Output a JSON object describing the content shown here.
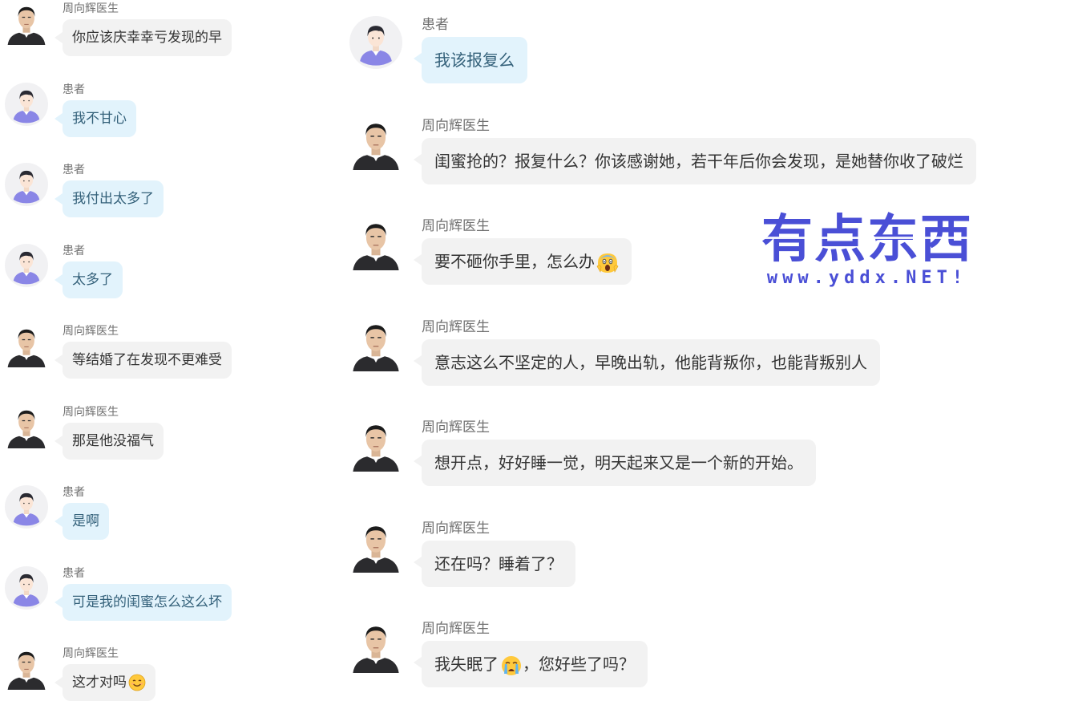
{
  "left_messages": [
    {
      "role": "doctor",
      "sender": "周向辉医生",
      "text": "你应该庆幸幸亏发现的早"
    },
    {
      "role": "patient",
      "sender": "患者",
      "text": "我不甘心"
    },
    {
      "role": "patient",
      "sender": "患者",
      "text": "我付出太多了"
    },
    {
      "role": "patient",
      "sender": "患者",
      "text": "太多了"
    },
    {
      "role": "doctor",
      "sender": "周向辉医生",
      "text": "等结婚了在发现不更难受"
    },
    {
      "role": "doctor",
      "sender": "周向辉医生",
      "text": "那是他没福气"
    },
    {
      "role": "patient",
      "sender": "患者",
      "text": "是啊"
    },
    {
      "role": "patient",
      "sender": "患者",
      "text": "可是我的闺蜜怎么这么坏"
    },
    {
      "role": "doctor",
      "sender": "周向辉医生",
      "text": "这才对吗",
      "emoji": "smiling-face-emoji"
    }
  ],
  "right_messages": [
    {
      "role": "patient",
      "sender": "患者",
      "text": "我该报复么"
    },
    {
      "role": "doctor",
      "sender": "周向辉医生",
      "text": "闺蜜抢的？报复什么？你该感谢她，若干年后你会发现，是她替你收了破烂"
    },
    {
      "role": "doctor",
      "sender": "周向辉医生",
      "text": "要不砸你手里，怎么办",
      "emoji": "screaming-face-emoji"
    },
    {
      "role": "doctor",
      "sender": "周向辉医生",
      "text": "意志这么不坚定的人，早晚出轨，他能背叛你，也能背叛别人"
    },
    {
      "role": "doctor",
      "sender": "周向辉医生",
      "text": "想开点，好好睡一觉，明天起来又是一个新的开始。"
    },
    {
      "role": "doctor",
      "sender": "周向辉医生",
      "text": "还在吗？睡着了？"
    },
    {
      "role": "doctor",
      "sender": "周向辉医生",
      "text": "我失眠了",
      "emoji": "crying-face-emoji",
      "text_after": "，您好些了吗？"
    }
  ],
  "watermark": {
    "title": "有点东西",
    "url": "www.yddx.NET!"
  },
  "colors": {
    "patient_bubble": "#e2f3fc",
    "patient_text": "#34617a",
    "doctor_bubble": "#f2f2f2",
    "doctor_text": "#333333",
    "sender_text": "#707070",
    "watermark": "#4a4fd6"
  }
}
